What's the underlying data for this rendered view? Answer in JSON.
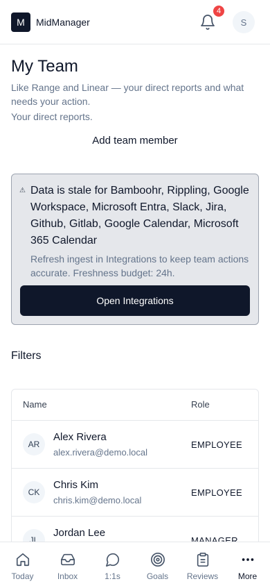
{
  "header": {
    "logo_letter": "M",
    "app_name": "MidManager",
    "notification_count": "4",
    "avatar_initial": "S"
  },
  "page": {
    "title": "My Team",
    "subtitle": "Like Range and Linear — your direct reports and what needs your action.",
    "caption": "Your direct reports.",
    "add_member_label": "Add team member"
  },
  "alert": {
    "icon": "warning-icon",
    "title": "Data is stale for Bamboohr, Rippling, Google Workspace, Microsoft Entra, Slack, Jira, Github, Gitlab, Google Calendar, Microsoft 365 Calendar",
    "description": "Refresh ingest in Integrations to keep team actions accurate. Freshness budget: 24h.",
    "button_label": "Open Integrations"
  },
  "filters_label": "Filters",
  "table": {
    "columns": [
      "Name",
      "Role"
    ],
    "rows": [
      {
        "initials": "AR",
        "name": "Alex Rivera",
        "email": "alex.rivera@demo.local",
        "role": "EMPLOYEE"
      },
      {
        "initials": "CK",
        "name": "Chris Kim",
        "email": "chris.kim@demo.local",
        "role": "EMPLOYEE"
      },
      {
        "initials": "JL",
        "name": "Jordan Lee",
        "email": "",
        "role": "MANAGER"
      }
    ]
  },
  "bottom_nav": {
    "items": [
      {
        "label": "Today",
        "icon": "home-icon"
      },
      {
        "label": "Inbox",
        "icon": "inbox-icon"
      },
      {
        "label": "1:1s",
        "icon": "chat-bubble-icon"
      },
      {
        "label": "Goals",
        "icon": "target-icon"
      },
      {
        "label": "Reviews",
        "icon": "clipboard-icon"
      },
      {
        "label": "More",
        "icon": "more-dots-icon"
      }
    ],
    "active": "More"
  },
  "colors": {
    "primary": "#0f172a",
    "muted_text": "#64748b",
    "badge": "#ef4444",
    "alert_bg": "#e5e7eb",
    "alert_border": "#9ca3af"
  }
}
